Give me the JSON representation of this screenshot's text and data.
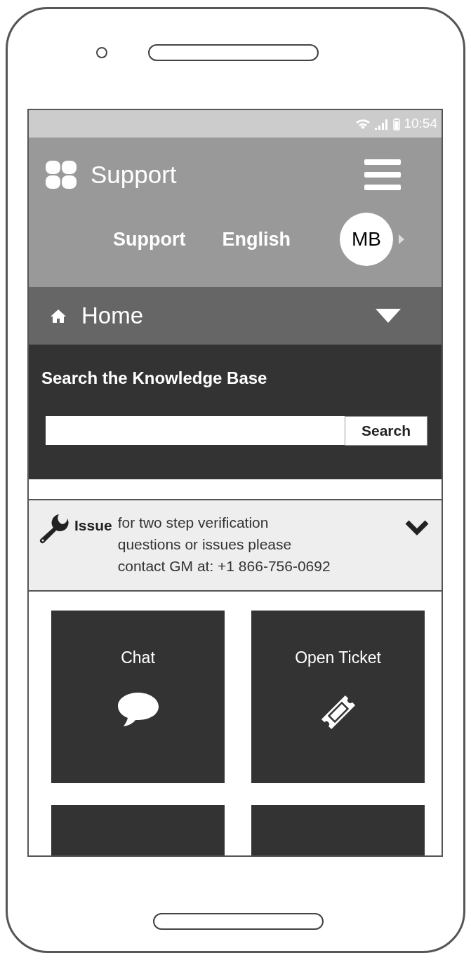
{
  "status_bar": {
    "time": "10:54"
  },
  "header": {
    "title": "Support",
    "links": [
      "Support",
      "English"
    ],
    "avatar": "MB"
  },
  "nav": {
    "label": "Home"
  },
  "search": {
    "heading": "Search the Knowledge Base",
    "button": "Search"
  },
  "notice": {
    "label": "Issue",
    "lines": [
      "for two step verification",
      "questions or issues please",
      "contact GM at: +1 866-756-0692"
    ]
  },
  "tiles": [
    {
      "kind": "chat",
      "label": "Chat"
    },
    {
      "kind": "ticket",
      "label": "Open Ticket"
    },
    {
      "kind": "blank"
    },
    {
      "kind": "blank"
    }
  ]
}
